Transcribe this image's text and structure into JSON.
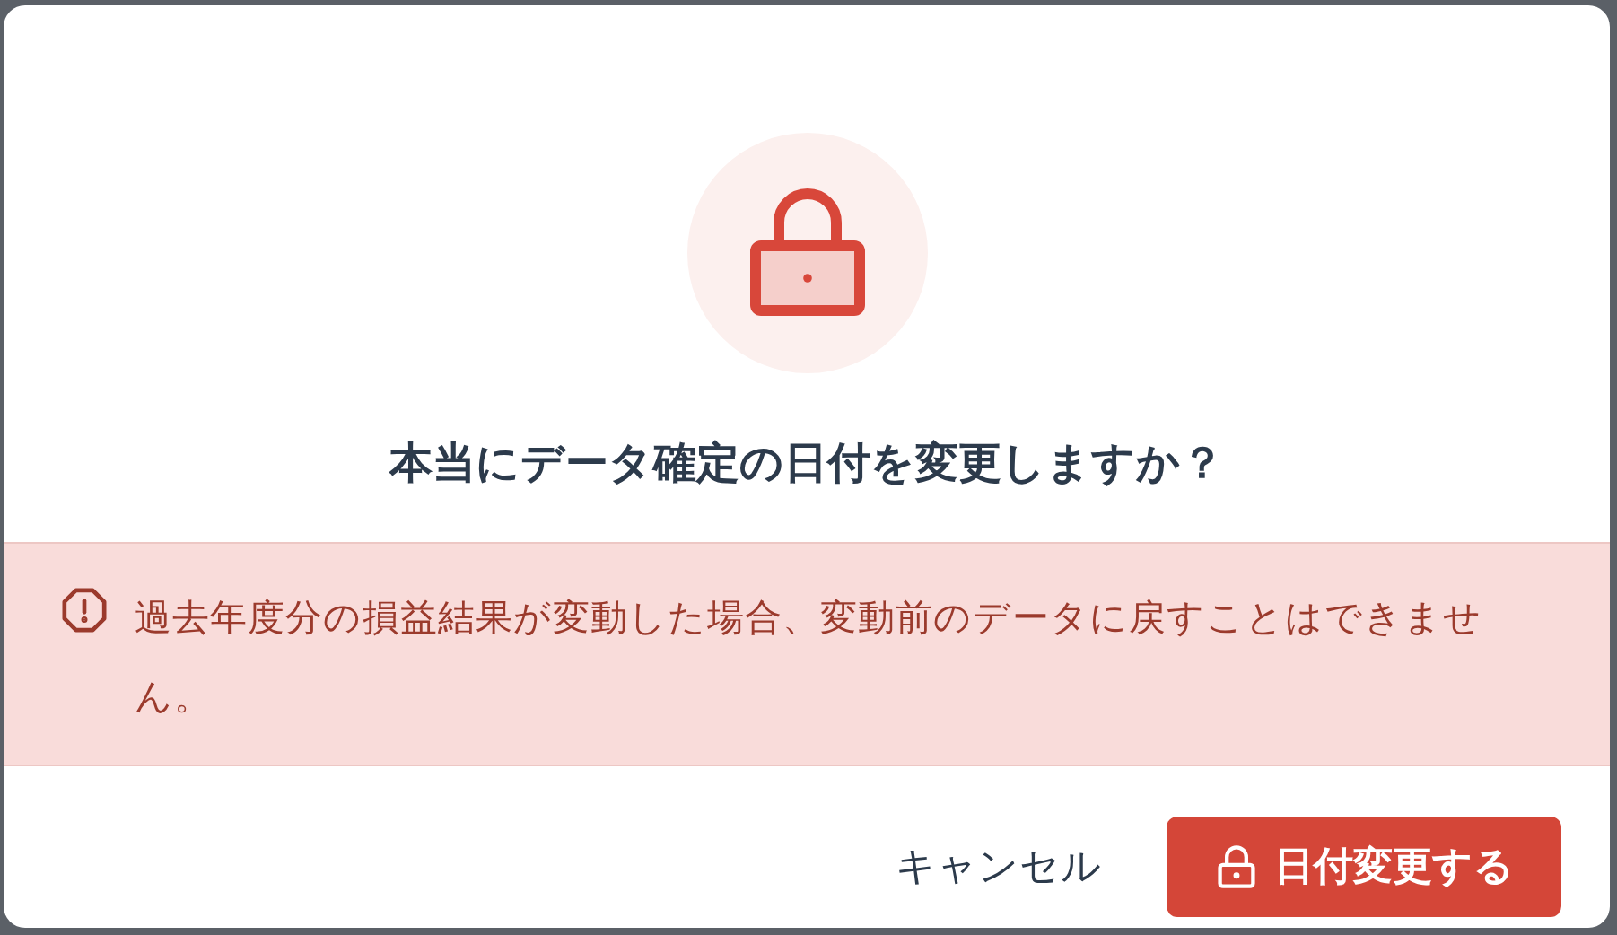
{
  "dialog": {
    "title": "本当にデータ確定の日付を変更しますか？",
    "warning": "過去年度分の損益結果が変動した場合、変動前のデータに戻すことはできません。",
    "buttons": [
      {
        "kind": "secondary",
        "label": "キャンセル"
      },
      {
        "kind": "danger",
        "label": "日付変更する"
      }
    ]
  }
}
